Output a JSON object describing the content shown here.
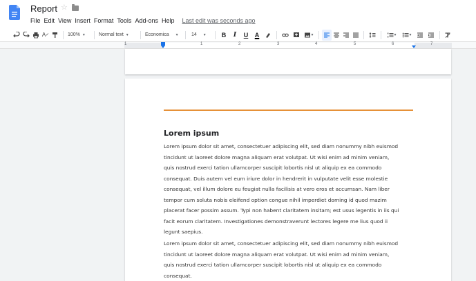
{
  "doc": {
    "title": "Report"
  },
  "menu": {
    "items": [
      "File",
      "Edit",
      "View",
      "Insert",
      "Format",
      "Tools",
      "Add-ons",
      "Help"
    ],
    "last_edit": "Last edit was seconds ago"
  },
  "toolbar": {
    "zoom": "100%",
    "style": "Normal text",
    "font": "Economica",
    "size": "14",
    "bold": "B",
    "italic": "I",
    "underline": "U",
    "text_color": "A"
  },
  "ruler": {
    "numbers": [
      "1",
      "1",
      "2",
      "3",
      "4",
      "5",
      "6",
      "7"
    ]
  },
  "content": {
    "heading": "Lorem ipsum",
    "para1_lines": [
      "Lorem ipsum dolor sit amet, consectetuer adipiscing elit, sed diam nonummy nibh euismod",
      "tincidunt ut laoreet dolore magna aliquam erat volutpat. Ut wisi enim ad minim veniam,",
      "quis nostrud exerci tation ullamcorper suscipit lobortis nisl ut aliquip ex ea commodo",
      "consequat. Duis autem vel eum iriure dolor in hendrerit in vulputate velit esse molestie",
      "consequat, vel illum dolore eu feugiat nulla facilisis at vero eros et accumsan. Nam liber",
      "tempor cum soluta nobis eleifend option congue nihil imperdiet doming id quod mazim",
      "placerat facer possim assum. Typi non habent claritatem insitam; est usus legentis in iis qui",
      "facit eorum claritatem. Investigationes demonstraverunt lectores legere me lius quod ii",
      "legunt saepius."
    ],
    "para2_lines": [
      "Lorem ipsum dolor sit amet, consectetuer adipiscing elit, sed diam nonummy nibh euismod",
      "tincidunt ut laoreet dolore magna aliquam erat volutpat. Ut wisi enim ad minim veniam,",
      "quis nostrud exerci tation ullamcorper suscipit lobortis nisl ut aliquip ex ea commodo",
      "consequat."
    ]
  },
  "colors": {
    "accent": "#e69138",
    "doc_blue": "#4285f4",
    "ruler_blue": "#1a73e8"
  }
}
